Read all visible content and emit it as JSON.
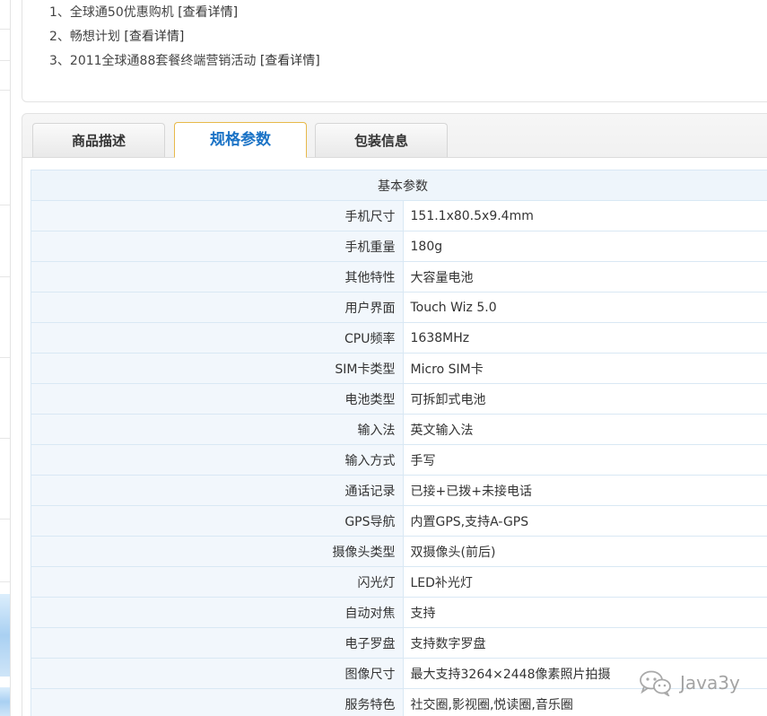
{
  "promotions": [
    {
      "index": "1、",
      "text": "全球通50优惠购机",
      "link": "[查看详情]"
    },
    {
      "index": "2、",
      "text": "畅想计划",
      "link": "[查看详情]"
    },
    {
      "index": "3、",
      "text": "2011全球通88套餐终端营销活动",
      "link": "[查看详情]"
    }
  ],
  "tabs": [
    {
      "label": "商品描述",
      "active": false
    },
    {
      "label": "规格参数",
      "active": true
    },
    {
      "label": "包装信息",
      "active": false
    }
  ],
  "spec_table": {
    "group_title": "基本参数",
    "rows": [
      {
        "key": "手机尺寸",
        "value": "151.1x80.5x9.4mm"
      },
      {
        "key": "手机重量",
        "value": "180g"
      },
      {
        "key": "其他特性",
        "value": "大容量电池"
      },
      {
        "key": "用户界面",
        "value": "Touch Wiz 5.0"
      },
      {
        "key": "CPU频率",
        "value": "1638MHz"
      },
      {
        "key": "SIM卡类型",
        "value": "Micro SIM卡"
      },
      {
        "key": "电池类型",
        "value": "可拆卸式电池"
      },
      {
        "key": "输入法",
        "value": "英文输入法"
      },
      {
        "key": "输入方式",
        "value": "手写"
      },
      {
        "key": "通话记录",
        "value": "已接+已拨+未接电话"
      },
      {
        "key": "GPS导航",
        "value": "内置GPS,支持A-GPS"
      },
      {
        "key": "摄像头类型",
        "value": "双摄像头(前后)"
      },
      {
        "key": "闪光灯",
        "value": "LED补光灯"
      },
      {
        "key": "自动对焦",
        "value": "支持"
      },
      {
        "key": "电子罗盘",
        "value": "支持数字罗盘"
      },
      {
        "key": "图像尺寸",
        "value": "最大支持3264×2448像素照片拍摄"
      },
      {
        "key": "服务特色",
        "value": "社交圈,影视圈,悦读圈,音乐圈"
      }
    ]
  },
  "watermark": {
    "text": "Java3y",
    "icon": "wechat-icon"
  },
  "colors": {
    "active_tab_text": "#1b73c6",
    "active_tab_border": "#e7b94a",
    "table_border": "#d9e8f4",
    "key_cell_bg": "#f2f7fc"
  }
}
